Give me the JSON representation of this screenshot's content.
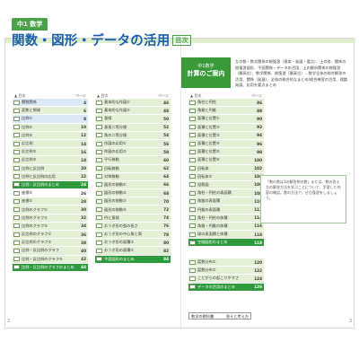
{
  "header": {
    "grade_tab": "中1 数学",
    "title": "関数・図形・データの活用",
    "toc_badge": "目次"
  },
  "guide": {
    "line1": "中1数学",
    "line2": "計算のご案内",
    "text": "左の数・数式関係の総復習（基本・発展・要点）、上の各、関係の総復習図形、平面関係・データの活用、上の解析関係の総復習（最高位）、数学関係、総復習（最高位）…数学全体の総合解答の活用、関係（発展）、全体の総合的なまとめ/総合練習の活用、理論発展、応用を要点まとめ"
  },
  "col_headers": {
    "label": "▲ 目次",
    "page": "ページ"
  },
  "col1": [
    {
      "label": "関数関係",
      "page": "4",
      "style": "blue"
    },
    {
      "label": "変数と領域",
      "page": "6",
      "style": "normal"
    },
    {
      "label": "比例①",
      "page": "8",
      "style": "blue"
    },
    {
      "label": "比例②",
      "page": "10",
      "style": "normal"
    },
    {
      "label": "比例③",
      "page": "12",
      "style": "normal"
    },
    {
      "label": "反比例",
      "page": "14",
      "style": "normal"
    },
    {
      "label": "反比例②",
      "page": "16",
      "style": "normal"
    },
    {
      "label": "反比例③",
      "page": "18",
      "style": "normal"
    },
    {
      "label": "比例と反比例",
      "page": "20",
      "style": "normal"
    },
    {
      "label": "比例と反比例の応用",
      "page": "22",
      "style": "normal"
    },
    {
      "label": "比例・反比例のまとめ",
      "page": "24",
      "style": "hl"
    },
    {
      "label": "座標①",
      "page": "26",
      "style": "white"
    },
    {
      "label": "座標②",
      "page": "28",
      "style": "normal"
    },
    {
      "label": "比例のグラフ①",
      "page": "30",
      "style": "normal"
    },
    {
      "label": "比例のグラフ②",
      "page": "32",
      "style": "normal"
    },
    {
      "label": "比例のグラフ③",
      "page": "34",
      "style": "normal"
    },
    {
      "label": "反比例のグラフ①",
      "page": "36",
      "style": "normal"
    },
    {
      "label": "反比例のグラフ②",
      "page": "38",
      "style": "normal"
    },
    {
      "label": "比例・反比例のグラフ",
      "page": "40",
      "style": "normal"
    },
    {
      "label": "比例・反比例のグラフ②",
      "page": "42",
      "style": "normal"
    },
    {
      "label": "比例・反比例のグラフのまとめ",
      "page": "44",
      "style": "hl"
    }
  ],
  "col2": [
    {
      "label": "基本的な作図①",
      "page": "46",
      "style": "normal"
    },
    {
      "label": "基本的な作図②",
      "page": "48",
      "style": "normal"
    },
    {
      "label": "垂線",
      "page": "50",
      "style": "normal"
    },
    {
      "label": "垂直二等分線",
      "page": "52",
      "style": "normal"
    },
    {
      "label": "角の二等分線",
      "page": "54",
      "style": "normal"
    },
    {
      "label": "作図の応用①",
      "page": "56",
      "style": "normal"
    },
    {
      "label": "作図の応用②",
      "page": "58",
      "style": "normal"
    },
    {
      "label": "平行移動",
      "page": "60",
      "style": "normal"
    },
    {
      "label": "回転移動",
      "page": "62",
      "style": "normal"
    },
    {
      "label": "対称移動",
      "page": "64",
      "style": "normal"
    },
    {
      "label": "図形の移動①",
      "page": "66",
      "style": "normal"
    },
    {
      "label": "図形の移動②",
      "page": "68",
      "style": "normal"
    },
    {
      "label": "図形の移動③",
      "page": "70",
      "style": "normal"
    },
    {
      "label": "図形の移動④",
      "page": "72",
      "style": "normal"
    },
    {
      "label": "円と直線",
      "page": "74",
      "style": "normal"
    },
    {
      "label": "おうぎ形の弧の長さ",
      "page": "76",
      "style": "normal"
    },
    {
      "label": "おうぎ形の中心角と周",
      "page": "78",
      "style": "normal"
    },
    {
      "label": "おうぎ形の面積①",
      "page": "80",
      "style": "normal"
    },
    {
      "label": "おうぎ形の面積②",
      "page": "82",
      "style": "normal"
    },
    {
      "label": "平面図形のまとめ",
      "page": "84",
      "style": "hl"
    }
  ],
  "col3": [
    {
      "label": "角柱と円柱",
      "page": "86",
      "style": "normal"
    },
    {
      "label": "角錐と円錐",
      "page": "88",
      "style": "normal"
    },
    {
      "label": "面積と位置①",
      "page": "90",
      "style": "normal"
    },
    {
      "label": "面積と位置②",
      "page": "92",
      "style": "normal"
    },
    {
      "label": "面積と位置③",
      "page": "94",
      "style": "normal"
    },
    {
      "label": "面積と位置④",
      "page": "96",
      "style": "normal"
    },
    {
      "label": "面積と位置⑤",
      "page": "98",
      "style": "normal"
    },
    {
      "label": "面積と位置⑥",
      "page": "100",
      "style": "normal"
    },
    {
      "label": "回転体",
      "page": "102",
      "style": "normal"
    },
    {
      "label": "回転体②",
      "page": "104",
      "style": "normal"
    },
    {
      "label": "投影図",
      "page": "106",
      "style": "normal"
    },
    {
      "label": "角柱・円柱の表面積",
      "page": "108",
      "style": "normal"
    },
    {
      "label": "角錐の表面積",
      "page": "110",
      "style": "normal"
    },
    {
      "label": "円錐の表面積",
      "page": "112",
      "style": "normal"
    },
    {
      "label": "角柱・円柱の体積",
      "page": "114",
      "style": "normal"
    },
    {
      "label": "角錐・円錐の体積",
      "page": "116",
      "style": "normal"
    },
    {
      "label": "球の表面積と体積",
      "page": "118",
      "style": "normal"
    },
    {
      "label": "空間図形のまとめ",
      "page": "118",
      "style": "hl"
    }
  ],
  "col3b": [
    {
      "label": "度数分布①",
      "page": "120",
      "style": "normal"
    },
    {
      "label": "度数分布②",
      "page": "122",
      "style": "normal"
    },
    {
      "label": "ことがらの起こりやすさ",
      "page": "124",
      "style": "normal"
    },
    {
      "label": "データの活用のまとめ",
      "page": "126",
      "style": "hl"
    }
  ],
  "note": "「数の数は3の解答例の数」または、数の答え方の解答方法を学ぶことについて、学習した内容の確認。数の方法で、ぜひ復習をしましょう。",
  "reference": {
    "label": "数学の教科書",
    "value": "答えと考え方"
  },
  "folios": {
    "left": "2",
    "right": "3"
  }
}
